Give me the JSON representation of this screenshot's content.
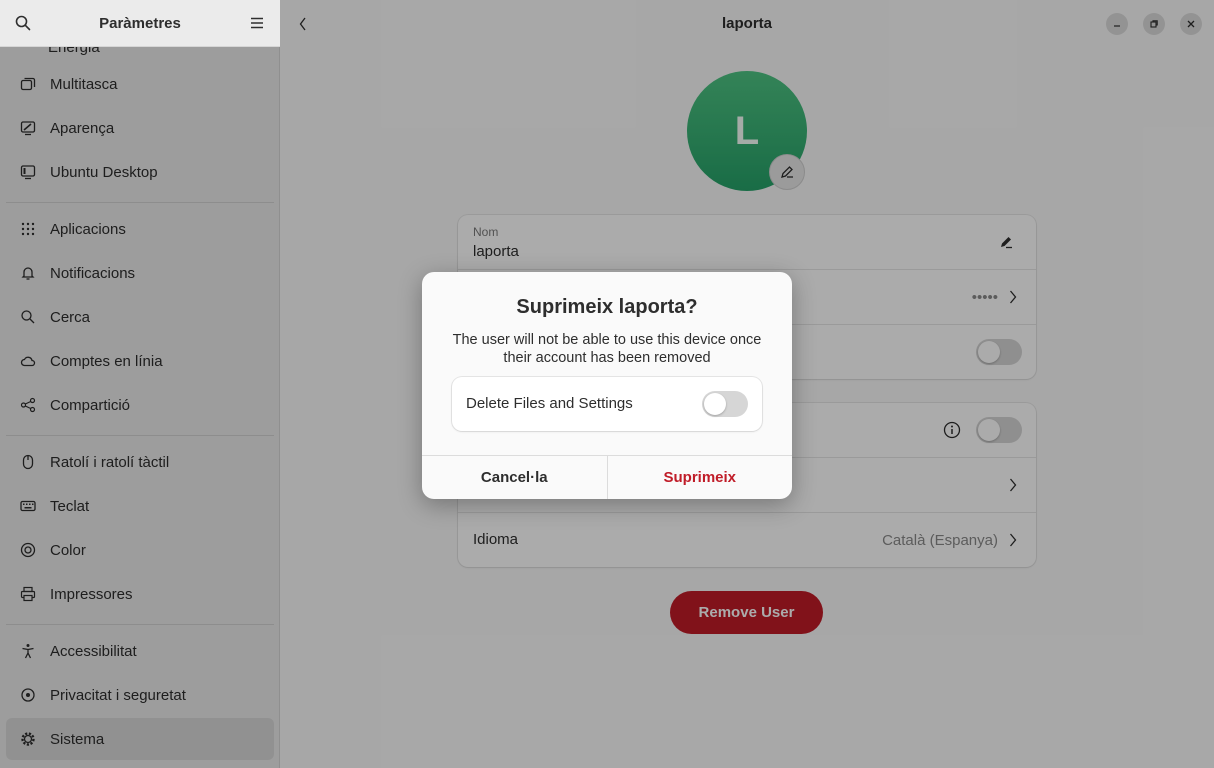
{
  "sidebar": {
    "title": "Paràmetres",
    "partial_item": "Energia",
    "items": [
      {
        "label": "Multitasca",
        "icon": "multitasking-icon"
      },
      {
        "label": "Aparença",
        "icon": "appearance-icon"
      },
      {
        "label": "Ubuntu Desktop",
        "icon": "desktop-icon"
      },
      {
        "label": "Aplicacions",
        "icon": "apps-grid-icon"
      },
      {
        "label": "Notificacions",
        "icon": "bell-icon"
      },
      {
        "label": "Cerca",
        "icon": "search-icon"
      },
      {
        "label": "Comptes en línia",
        "icon": "cloud-icon"
      },
      {
        "label": "Compartició",
        "icon": "share-icon"
      },
      {
        "label": "Ratolí i ratolí tàctil",
        "icon": "mouse-icon"
      },
      {
        "label": "Teclat",
        "icon": "keyboard-icon"
      },
      {
        "label": "Color",
        "icon": "color-icon"
      },
      {
        "label": "Impressores",
        "icon": "printer-icon"
      },
      {
        "label": "Accessibilitat",
        "icon": "accessibility-icon"
      },
      {
        "label": "Privacitat i seguretat",
        "icon": "lock-icon"
      },
      {
        "label": "Sistema",
        "icon": "gear-icon",
        "active": true
      }
    ]
  },
  "main": {
    "title": "laporta",
    "avatar_letter": "L",
    "name_label": "Nom",
    "name_value": "laporta",
    "password_masked": "•••••",
    "language_label": "Idioma",
    "language_value": "Català (Espanya)",
    "remove_button": "Remove User"
  },
  "dialog": {
    "title": "Suprimeix laporta?",
    "body": "The user will not be able to use this device once their account has been removed",
    "option_label": "Delete Files and Settings",
    "option_enabled": false,
    "cancel_label": "Cancel·la",
    "confirm_label": "Suprimeix"
  },
  "colors": {
    "destructive": "#c01c28",
    "avatar": "#2ec27e"
  }
}
